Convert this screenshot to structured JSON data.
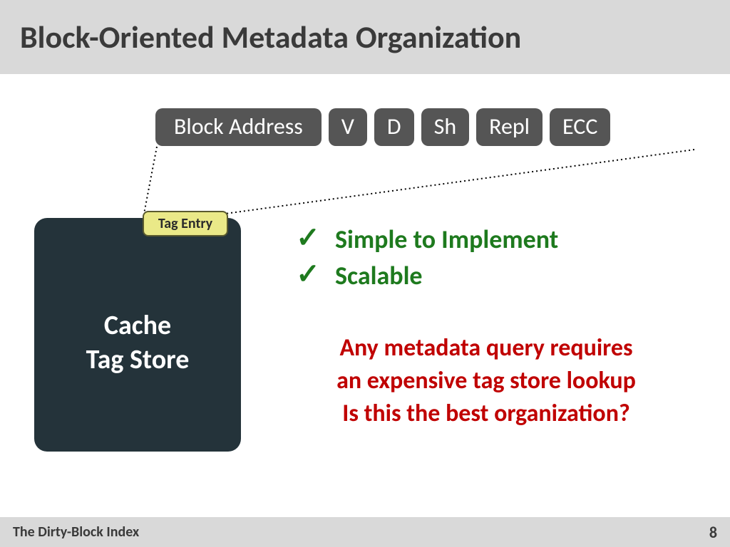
{
  "title": "Block-Oriented Metadata Organization",
  "pills": {
    "addr": "Block Address",
    "v": "V",
    "d": "D",
    "sh": "Sh",
    "repl": "Repl",
    "ecc": "ECC"
  },
  "tag_entry": "Tag Entry",
  "cache_box": {
    "line1": "Cache",
    "line2": "Tag Store"
  },
  "checks": {
    "item1": "Simple to Implement",
    "item2": "Scalable"
  },
  "red": {
    "line1": "Any metadata query requires",
    "line2": "an expensive tag store lookup",
    "line3": "Is this the best organization?"
  },
  "footer": {
    "left": "The Dirty-Block Index",
    "page": "8"
  }
}
